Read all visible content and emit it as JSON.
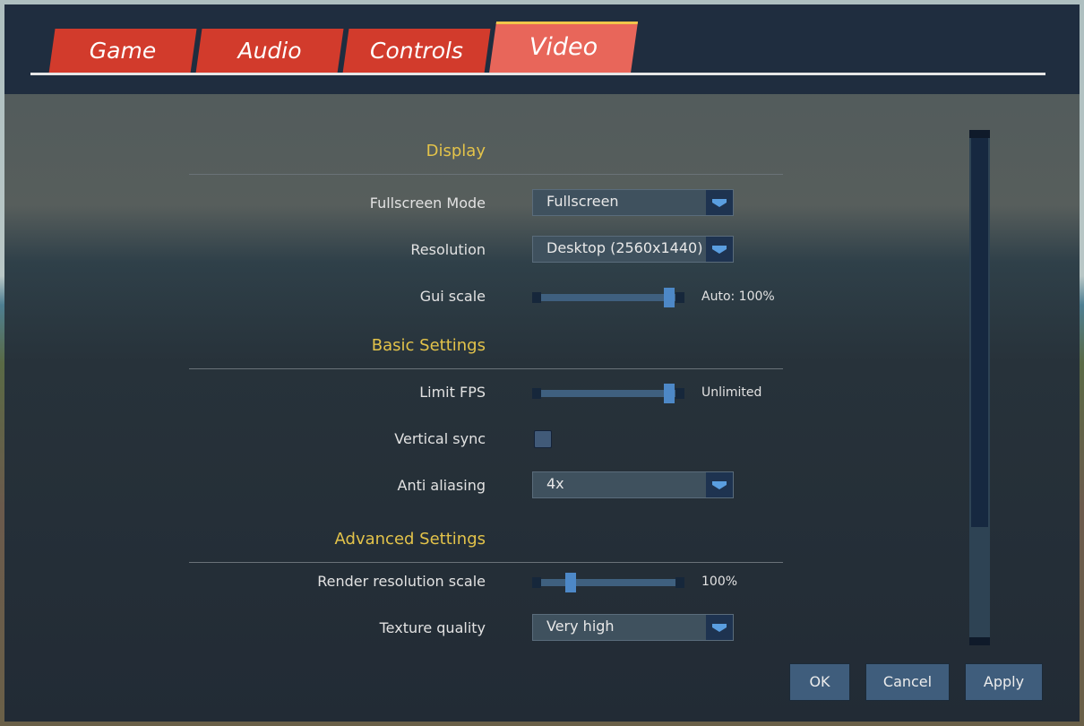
{
  "tabs": [
    {
      "label": "Game",
      "active": false
    },
    {
      "label": "Audio",
      "active": false
    },
    {
      "label": "Controls",
      "active": false
    },
    {
      "label": "Video",
      "active": true
    }
  ],
  "sections": {
    "display": {
      "title": "Display",
      "fullscreen_mode": {
        "label": "Fullscreen Mode",
        "value": "Fullscreen"
      },
      "resolution": {
        "label": "Resolution",
        "value": "Desktop (2560x1440)"
      },
      "gui_scale": {
        "label": "Gui scale",
        "value_text": "Auto: 100%",
        "fraction": 0.95
      }
    },
    "basic": {
      "title": "Basic Settings",
      "limit_fps": {
        "label": "Limit FPS",
        "value_text": "Unlimited",
        "fraction": 0.95
      },
      "vertical_sync": {
        "label": "Vertical sync",
        "checked": false
      },
      "anti_aliasing": {
        "label": "Anti aliasing",
        "value": "4x"
      }
    },
    "advanced": {
      "title": "Advanced Settings",
      "render_scale": {
        "label": "Render resolution scale",
        "value_text": "100%",
        "fraction": 0.22
      },
      "texture_quality": {
        "label": "Texture quality",
        "value": "Very high"
      }
    }
  },
  "scrollbar": {
    "position_fraction": 0.0,
    "visible_fraction": 0.78
  },
  "buttons": {
    "ok": "OK",
    "cancel": "Cancel",
    "apply": "Apply"
  },
  "colors": {
    "tab": "#d23b2c",
    "tab_active": "#e8665a",
    "heading": "#e3c34a",
    "accent": "#4d88c7"
  }
}
